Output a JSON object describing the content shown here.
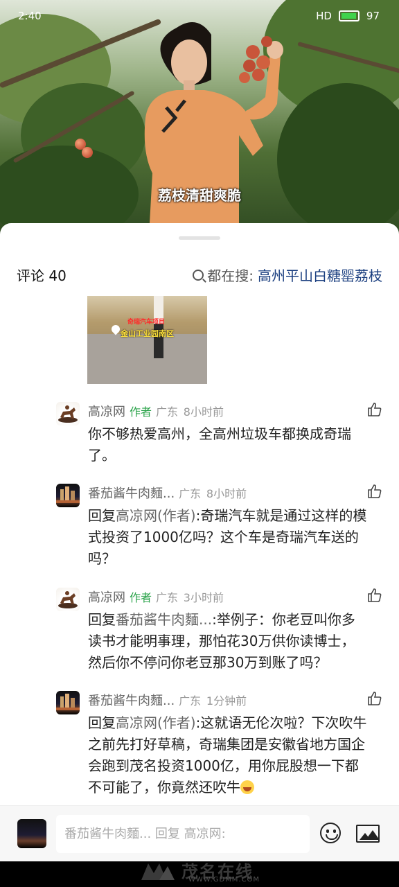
{
  "status_bar": {
    "time": "2:40",
    "network": "HD",
    "battery": "97"
  },
  "video": {
    "subtitle": "荔枝清甜爽脆"
  },
  "comments_header": {
    "count_label": "评论 40",
    "search_prefix": "都在搜:",
    "search_query": "高州平山白糖罂荔枝"
  },
  "thumbnail": {
    "overlay_line1": "奇瑞汽车项目",
    "overlay_line2": "金山工业园南区"
  },
  "comments": [
    {
      "user": "高凉网",
      "author_tag": "作者",
      "location": "广东",
      "time": "8小时前",
      "lines": [
        "你不够热爱高州，全高州垃圾车都换成奇瑞",
        "了。"
      ]
    },
    {
      "user": "番茄酱牛肉麵...",
      "location": "广东",
      "time": "8小时前",
      "reply_prefix": "回复",
      "reply_to": "高凉网(作者)",
      "lines": [
        ":奇瑞汽车就是通过这样的模",
        "式投资了1000亿吗？这个车是奇瑞汽车送的",
        "吗？"
      ]
    },
    {
      "user": "高凉网",
      "author_tag": "作者",
      "location": "广东",
      "time": "3小时前",
      "reply_prefix": "回复",
      "reply_to": "番茄酱牛肉麵...",
      "lines": [
        ":举例子：你老豆叫你多",
        "读书才能明事理，那怕花30万供你读博士，",
        "然后你不停问你老豆那30万到账了吗？"
      ]
    },
    {
      "user": "番茄酱牛肉麵...",
      "location": "广东",
      "time": "1分钟前",
      "reply_prefix": "回复",
      "reply_to": "高凉网(作者)",
      "lines": [
        ":这就语无伦次啦？下次吹牛",
        "之前先打好草稿，奇瑞集团是安徽省地方国企",
        "会跑到茂名投资1000亿，用你屁股想一下都",
        "不可能了，你竟然还吹牛"
      ]
    }
  ],
  "input_bar": {
    "placeholder": "番茄酱牛肉麵... 回复 高凉网:"
  },
  "watermark": {
    "brand": "茂名在线",
    "url": "WWW.GDMM.COM"
  },
  "colors": {
    "author_tag": "#2aa34a",
    "search_query": "#1a3e7f",
    "battery": "#3fd34c"
  }
}
